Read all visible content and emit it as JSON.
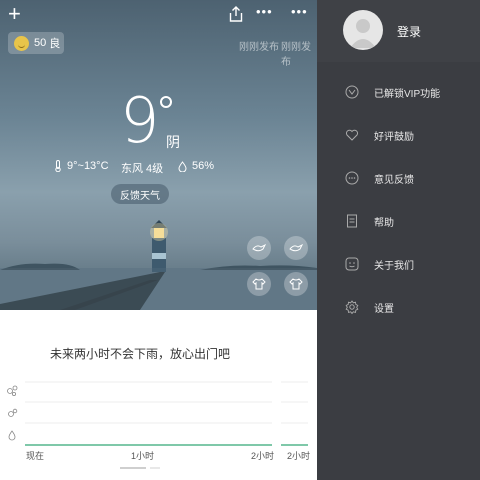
{
  "weather": {
    "aqi": {
      "value": "50",
      "level": "良"
    },
    "publish": [
      "刚刚发布",
      "刚刚发布"
    ],
    "temperature": "9",
    "condition": "阴",
    "range": "9°~13°C",
    "wind": "东风 4级",
    "humidity": "56%",
    "feedback_button": "反馈天气",
    "rain_message": "未来两小时不会下雨，放心出门吧",
    "chart_x_labels": [
      "现在",
      "1小时",
      "2小时",
      "2小时"
    ]
  },
  "drawer": {
    "login": "登录",
    "items": [
      {
        "label": "已解锁VIP功能",
        "icon": "vip-icon"
      },
      {
        "label": "好评鼓励",
        "icon": "heart-icon"
      },
      {
        "label": "意见反馈",
        "icon": "chat-icon"
      },
      {
        "label": "帮助",
        "icon": "document-icon"
      },
      {
        "label": "关于我们",
        "icon": "face-icon"
      },
      {
        "label": "设置",
        "icon": "gear-icon"
      }
    ]
  },
  "colors": {
    "drawer_bg": "#3b3d42",
    "aqi_good": "#e8c44a",
    "chart_line": "#7fc8a9"
  }
}
